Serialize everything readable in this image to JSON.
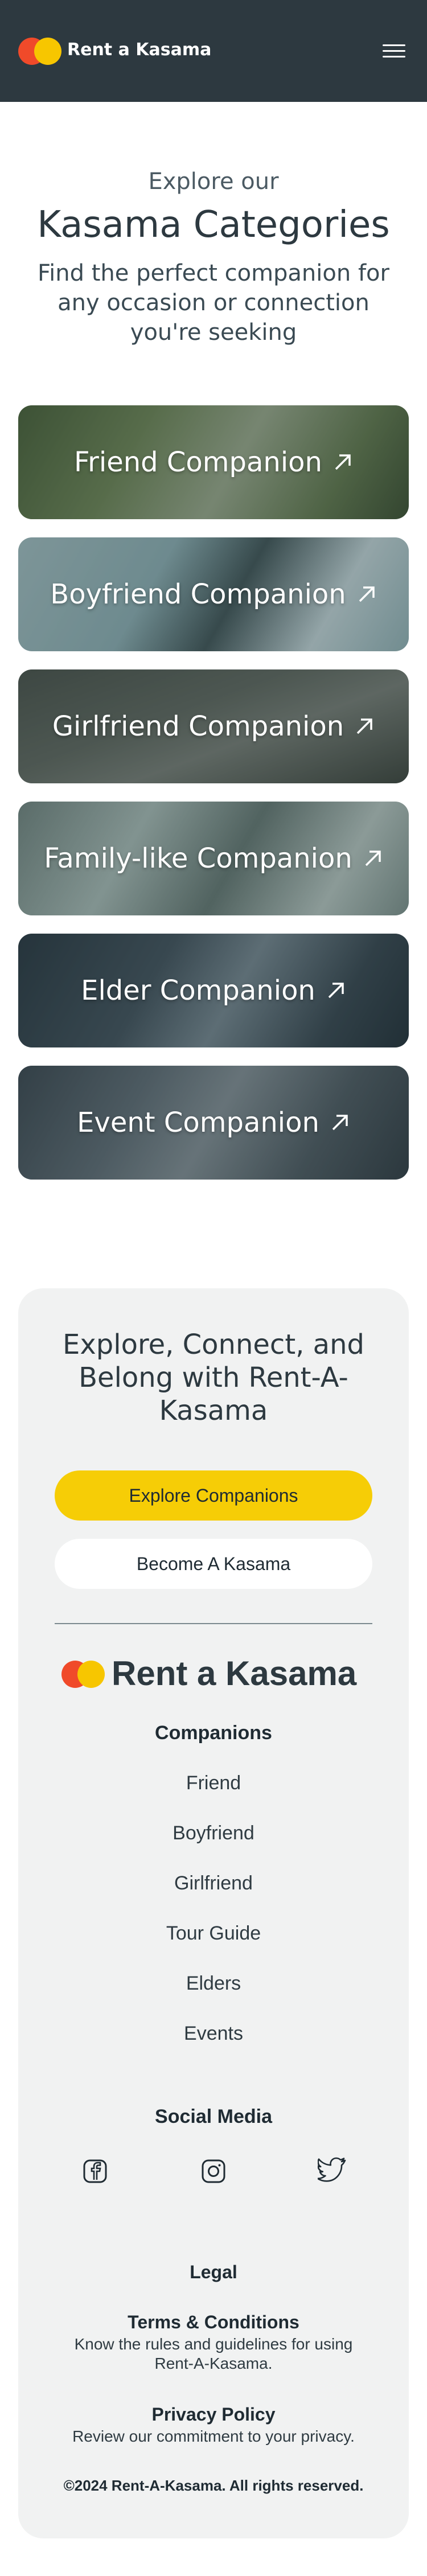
{
  "header": {
    "brand": "Rent a Kasama",
    "menu_icon": "hamburger-icon"
  },
  "intro": {
    "kicker": "Explore our",
    "title": "Kasama Categories",
    "subtitle": "Find the perfect companion for any occasion or connection you're seeking"
  },
  "categories": [
    {
      "label": "Friend Companion",
      "icon": "arrow-up-right-icon"
    },
    {
      "label": "Boyfriend Companion",
      "icon": "arrow-up-right-icon"
    },
    {
      "label": "Girlfriend Companion",
      "icon": "arrow-up-right-icon"
    },
    {
      "label": "Family-like Companion",
      "icon": "arrow-up-right-icon"
    },
    {
      "label": "Elder Companion",
      "icon": "arrow-up-right-icon"
    },
    {
      "label": "Event Companion",
      "icon": "arrow-up-right-icon"
    }
  ],
  "cta": {
    "title": "Explore, Connect, and Belong with Rent-A-Kasama",
    "explore_label": "Explore Companions",
    "become_label": "Become A Kasama"
  },
  "footer": {
    "brand": "Rent a Kasama",
    "companions_heading": "Companions",
    "companions": [
      "Friend",
      "Boyfriend",
      "Girlfriend",
      "Tour Guide",
      "Elders",
      "Events"
    ],
    "social_heading": "Social Media",
    "social_icons": [
      "facebook-icon",
      "instagram-icon",
      "twitter-icon"
    ],
    "legal_heading": "Legal",
    "terms_title": "Terms & Conditions",
    "terms_desc": "Know the rules and guidelines for using Rent-A-Kasama.",
    "privacy_title": "Privacy Policy",
    "privacy_desc": "Review our commitment to your privacy.",
    "copyright": "©2024 Rent-A-Kasama. All rights reserved."
  },
  "colors": {
    "header_bg": "#2d3940",
    "accent_yellow": "#f6cd06",
    "logo_red": "#f04a2a",
    "logo_yellow": "#f7c600",
    "panel_bg": "#f1f2f2"
  }
}
